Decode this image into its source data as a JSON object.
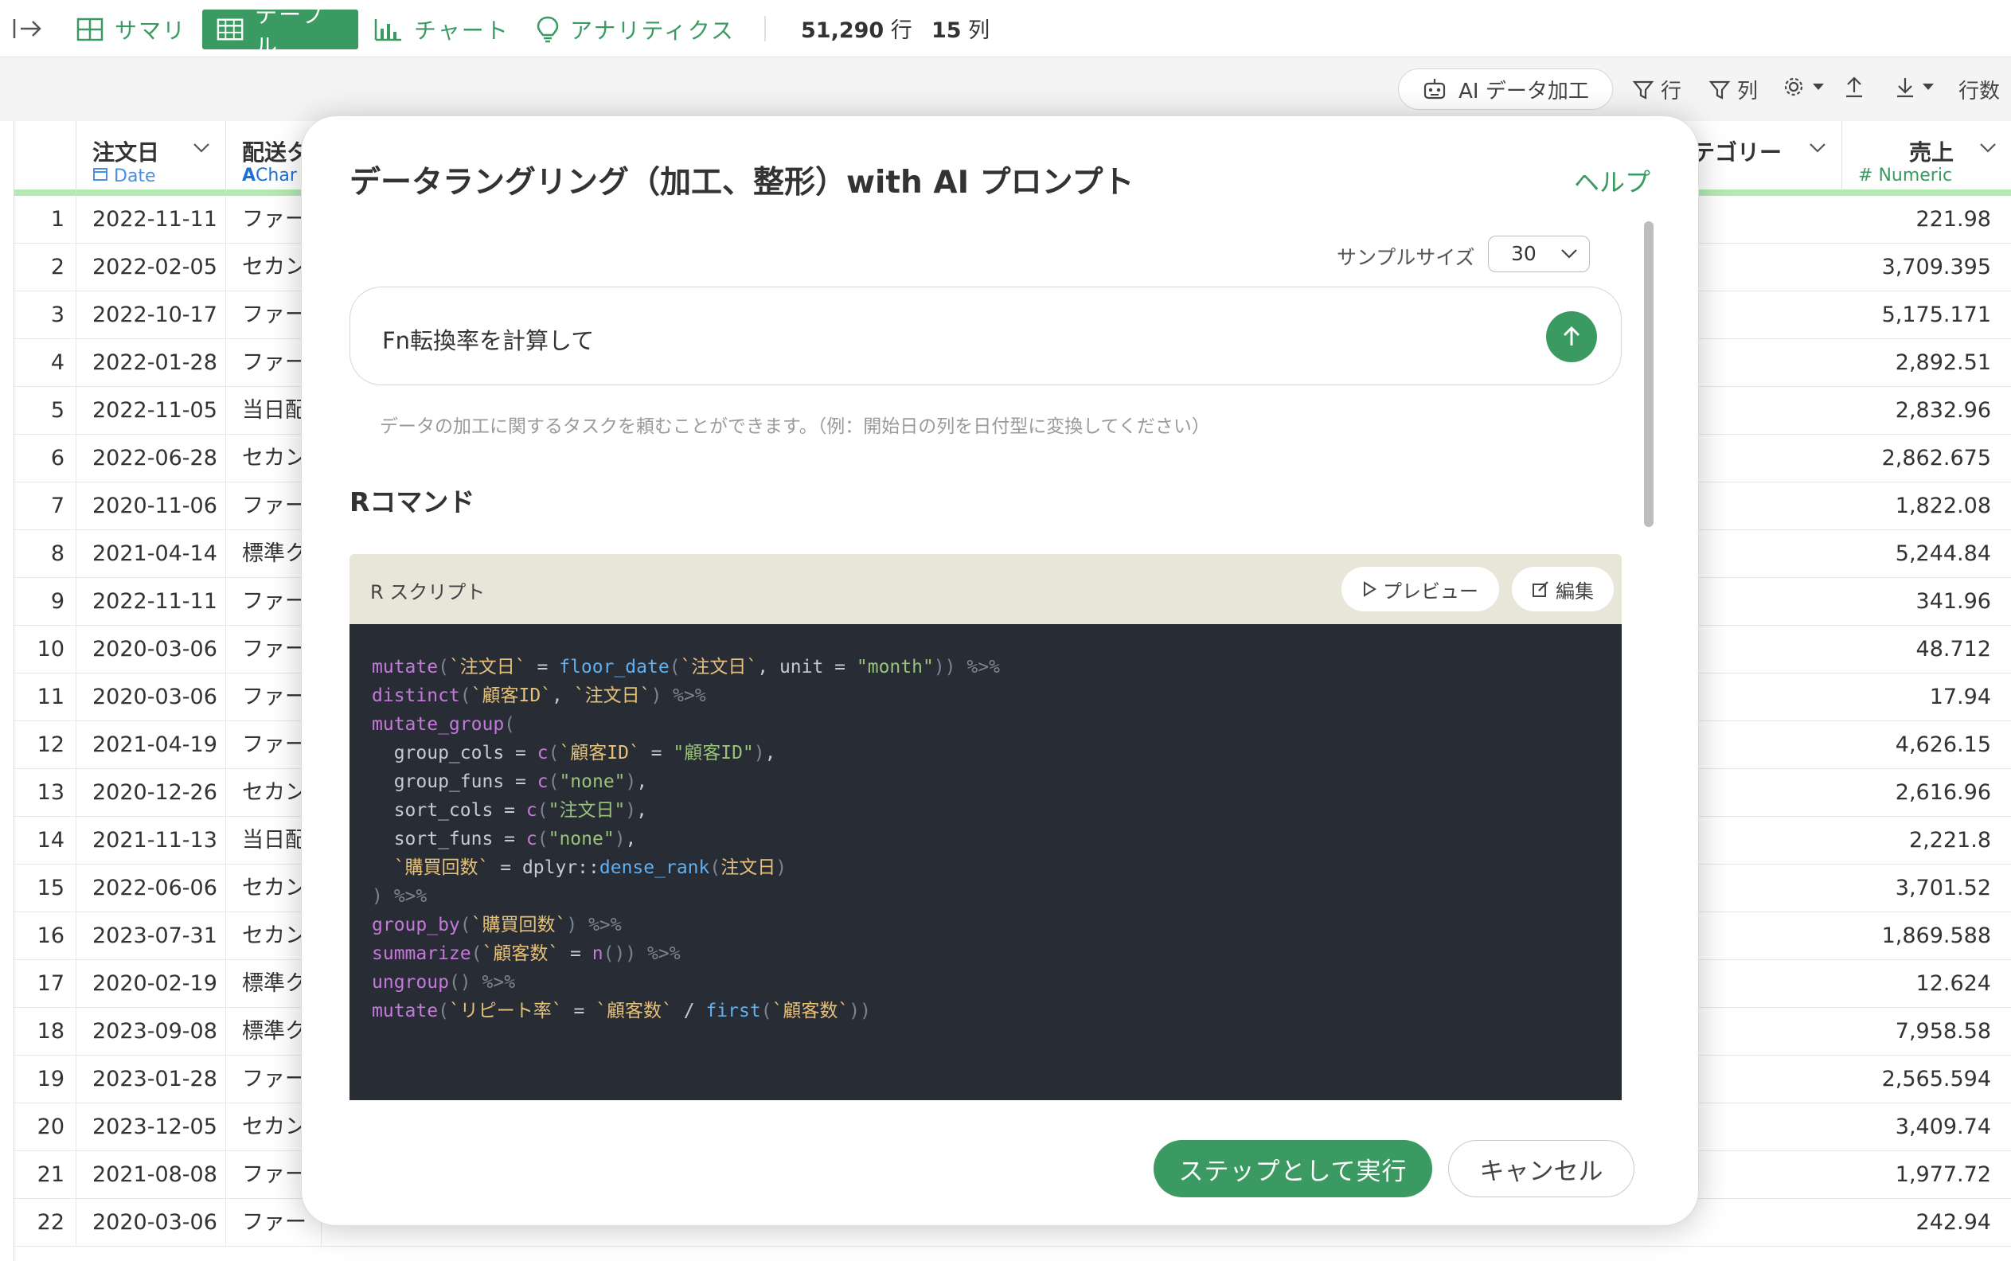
{
  "toolbar": {
    "tabs": [
      {
        "label": "サマリ",
        "icon": "grid-icon"
      },
      {
        "label": "テーブル",
        "icon": "table-icon",
        "active": true
      },
      {
        "label": "チャート",
        "icon": "bar-chart-icon"
      },
      {
        "label": "アナリティクス",
        "icon": "lightbulb-icon"
      }
    ],
    "rows_count": "51,290",
    "rows_unit": "行",
    "cols_count": "15",
    "cols_unit": "列"
  },
  "toolbar2": {
    "ai_button": "AI データ加工",
    "filter_rows": "行",
    "filter_cols": "列",
    "row_count_label": "行数"
  },
  "columns": {
    "date": {
      "name": "注文日",
      "type": "Date"
    },
    "ship": {
      "name": "配送タ",
      "type": "Char"
    },
    "category": {
      "name": "カテゴリー"
    },
    "sales": {
      "name": "売上",
      "type": "Numeric"
    }
  },
  "rows": [
    {
      "n": "1",
      "date": "2022-11-11",
      "ship": "ファー",
      "sales": "221.98"
    },
    {
      "n": "2",
      "date": "2022-02-05",
      "ship": "セカン",
      "sales": "3,709.395"
    },
    {
      "n": "3",
      "date": "2022-10-17",
      "ship": "ファー",
      "sales": "5,175.171"
    },
    {
      "n": "4",
      "date": "2022-01-28",
      "ship": "ファー",
      "sales": "2,892.51"
    },
    {
      "n": "5",
      "date": "2022-11-05",
      "ship": "当日配",
      "sales": "2,832.96"
    },
    {
      "n": "6",
      "date": "2022-06-28",
      "ship": "セカン",
      "sales": "2,862.675"
    },
    {
      "n": "7",
      "date": "2020-11-06",
      "ship": "ファー",
      "sales": "1,822.08"
    },
    {
      "n": "8",
      "date": "2021-04-14",
      "ship": "標準ク",
      "sales": "5,244.84"
    },
    {
      "n": "9",
      "date": "2022-11-11",
      "ship": "ファー",
      "sales": "341.96"
    },
    {
      "n": "10",
      "date": "2020-03-06",
      "ship": "ファー",
      "sales": "48.712"
    },
    {
      "n": "11",
      "date": "2020-03-06",
      "ship": "ファー",
      "sales": "17.94"
    },
    {
      "n": "12",
      "date": "2021-04-19",
      "ship": "ファー",
      "sales": "4,626.15"
    },
    {
      "n": "13",
      "date": "2020-12-26",
      "ship": "セカン",
      "sales": "2,616.96"
    },
    {
      "n": "14",
      "date": "2021-11-13",
      "ship": "当日配",
      "sales": "2,221.8"
    },
    {
      "n": "15",
      "date": "2022-06-06",
      "ship": "セカン",
      "sales": "3,701.52"
    },
    {
      "n": "16",
      "date": "2023-07-31",
      "ship": "セカン",
      "sales": "1,869.588"
    },
    {
      "n": "17",
      "date": "2020-02-19",
      "ship": "標準ク",
      "sales": "12.624"
    },
    {
      "n": "18",
      "date": "2023-09-08",
      "ship": "標準ク",
      "sales": "7,958.58"
    },
    {
      "n": "19",
      "date": "2023-01-28",
      "ship": "ファー",
      "sales": "2,565.594"
    },
    {
      "n": "20",
      "date": "2023-12-05",
      "ship": "セカン",
      "sales": "3,409.74"
    },
    {
      "n": "21",
      "date": "2021-08-08",
      "ship": "ファー",
      "sales": "1,977.72"
    },
    {
      "n": "22",
      "date": "2020-03-06",
      "ship": "ファー",
      "sales": "242.94"
    }
  ],
  "modal": {
    "title": "データラングリング（加工、整形）with AI プロンプト",
    "help": "ヘルプ",
    "sample_size_label": "サンプルサイズ",
    "sample_size_value": "30",
    "prompt_value": "Fn転換率を計算して",
    "hint": "データの加工に関するタスクを頼むことができます。（例：開始日の列を日付型に変換してください）",
    "section_title": "Rコマンド",
    "script_label": "R スクリプト",
    "preview_button": "プレビュー",
    "edit_button": "編集",
    "code_lines": [
      "mutate(`注文日` = floor_date(`注文日`, unit = \"month\")) %>%",
      "distinct(`顧客ID`, `注文日`) %>%",
      "mutate_group(",
      "  group_cols = c(`顧客ID` = \"顧客ID\"),",
      "  group_funs = c(\"none\"),",
      "  sort_cols = c(\"注文日\"),",
      "  sort_funs = c(\"none\"),",
      "  `購買回数` = dplyr::dense_rank(注文日)",
      ") %>%",
      "group_by(`購買回数`) %>%",
      "summarize(`顧客数` = n()) %>%",
      "ungroup() %>%",
      "mutate(`リピート率` = `顧客数` / first(`顧客数`))"
    ],
    "run_button": "ステップとして実行",
    "cancel_button": "キャンセル"
  },
  "colors": {
    "accent_green": "#3a9a61",
    "header_stripe": "#b5e8b3",
    "code_bg": "#282c34",
    "code_head_bg": "#e8e6d9"
  }
}
